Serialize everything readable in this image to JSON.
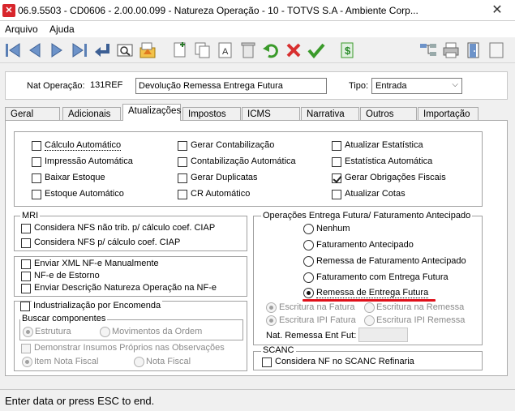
{
  "window": {
    "title": "06.9.5503 - CD0606 - 2.00.00.099 - Natureza Operação - 10 - TOTVS S.A - Ambiente Corp...",
    "close": "✕"
  },
  "menu": [
    "Arquivo",
    "Ajuda"
  ],
  "header": {
    "nat_label": "Nat Operação:",
    "nat_code": "131REF",
    "nat_desc": "Devolução Remessa Entrega Futura",
    "tipo_label": "Tipo:",
    "tipo_value": "Entrada"
  },
  "tabs": [
    "Geral",
    "Adicionais",
    "Atualizações",
    "Impostos",
    "ICMS",
    "Narrativa",
    "Outros",
    "Importação"
  ],
  "active_tab": "Atualizações",
  "updates": {
    "col1": [
      {
        "label": "Cálculo Automático",
        "checked": false
      },
      {
        "label": "Impressão Automática",
        "checked": false
      },
      {
        "label": "Baixar Estoque",
        "checked": false
      },
      {
        "label": "Estoque Automático",
        "checked": false
      }
    ],
    "col2": [
      {
        "label": "Gerar Contabilização",
        "checked": false
      },
      {
        "label": "Contabilização Automática",
        "checked": false
      },
      {
        "label": "Gerar Duplicatas",
        "checked": false
      },
      {
        "label": "CR Automático",
        "checked": false
      }
    ],
    "col3": [
      {
        "label": "Atualizar Estatística",
        "checked": false
      },
      {
        "label": "Estatística Automática",
        "checked": false
      },
      {
        "label": "Gerar Obrigações Fiscais",
        "checked": true
      },
      {
        "label": "Atualizar Cotas",
        "checked": false
      }
    ]
  },
  "mri": {
    "title": "MRI",
    "items": [
      "Considera NFS não trib. p/ cálculo coef. CIAP",
      "Considera NFS p/ cálculo coef. CIAP"
    ]
  },
  "nfe": {
    "items": [
      "Enviar XML NF-e Manualmente",
      "NF-e de Estorno",
      "Enviar Descrição Natureza Operação na NF-e"
    ]
  },
  "industrializacao": {
    "title": "Industrialização por Encomenda",
    "buscar_title": "Buscar componentes",
    "buscar_options": [
      "Estrutura",
      "Movimentos da Ordem"
    ],
    "demonstrar": "Demonstrar Insumos Próprios nas Observações",
    "demo_options": [
      "Item Nota Fiscal",
      "Nota Fiscal"
    ]
  },
  "operacoes": {
    "title": "Operações Entrega Futura/ Faturamento Antecipado",
    "options": [
      "Nenhum",
      "Faturamento Antecipado",
      "Remessa de Faturamento Antecipado",
      "Faturamento com Entrega Futura",
      "Remessa de Entrega Futura"
    ],
    "selected": "Remessa de Entrega Futura",
    "escrita": [
      "Escritura na Fatura",
      "Escritura na Remessa",
      "Escritura IPI Fatura",
      "Escritura IPI Remessa"
    ],
    "nat_remessa_label": "Nat. Remessa Ent Fut:"
  },
  "scanc": {
    "title": "SCANC",
    "item": "Considera NF no SCANC Refinaria"
  },
  "status": "Enter data or press ESC to end.",
  "colors": {
    "highlight": "#e0101a",
    "brand": "#d8262c"
  }
}
